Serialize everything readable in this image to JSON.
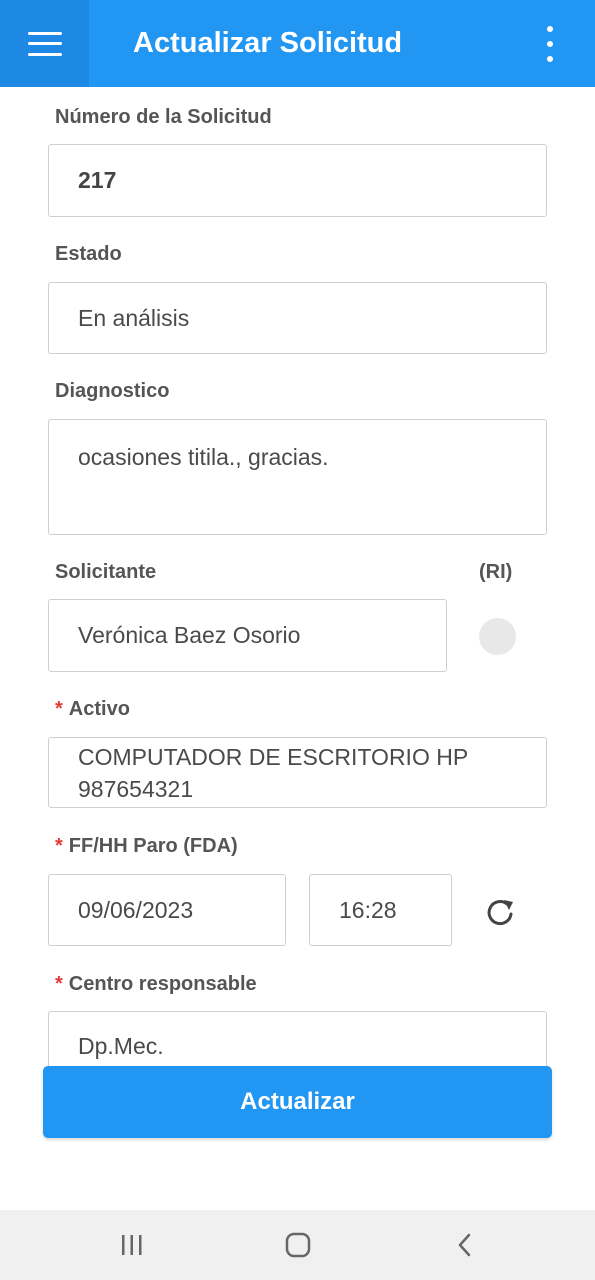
{
  "appbar": {
    "title": "Actualizar Solicitud",
    "menu_icon": "hamburger-menu-icon",
    "overflow_icon": "more-vertical-icon",
    "color": "#2196F3"
  },
  "form": {
    "numero": {
      "label": "Número de la Solicitud",
      "value": "217"
    },
    "estado": {
      "label": "Estado",
      "value": "En análisis"
    },
    "diagnostico": {
      "label": "Diagnostico",
      "value": "ocasiones titila., gracias."
    },
    "solicitante": {
      "label": "Solicitante",
      "value": "Verónica Baez Osorio",
      "ri_label": "(RI)"
    },
    "activo": {
      "required": "*",
      "label": "Activo",
      "line1": "COMPUTADOR DE ESCRITORIO HP",
      "line2": "987654321"
    },
    "paro": {
      "required": "*",
      "label": "FF/HH Paro (FDA)",
      "date": "09/06/2023",
      "time": "16:28",
      "refresh_icon": "refresh-icon"
    },
    "centro": {
      "required": "*",
      "label": "Centro responsable",
      "value": "Dp.Mec."
    }
  },
  "submit_label": "Actualizar",
  "navbar": {
    "recents_icon": "recent-apps-icon",
    "home_icon": "home-icon",
    "back_icon": "back-icon"
  },
  "colors": {
    "accent": "#2196F3",
    "required": "#e53935"
  }
}
